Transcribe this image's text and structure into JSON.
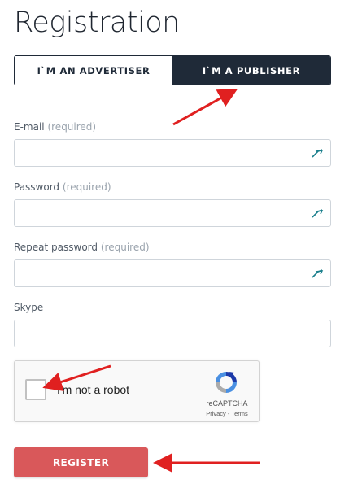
{
  "title": "Registration",
  "toggle": {
    "advertiser": "I`M AN ADVERTISER",
    "publisher": "I`M A PUBLISHER"
  },
  "fields": {
    "email": {
      "label": "E-mail",
      "required": "(required)",
      "value": ""
    },
    "password": {
      "label": "Password",
      "required": "(required)",
      "value": ""
    },
    "repeat_password": {
      "label": "Repeat password",
      "required": "(required)",
      "value": ""
    },
    "skype": {
      "label": "Skype",
      "value": ""
    }
  },
  "captcha": {
    "label": "I'm not a robot",
    "brand": "reCAPTCHA",
    "privacy": "Privacy",
    "separator": " - ",
    "terms": "Terms"
  },
  "register": "REGISTER",
  "colors": {
    "dark": "#1f2a38",
    "accent": "#d9585a",
    "arrow": "#e02020"
  }
}
